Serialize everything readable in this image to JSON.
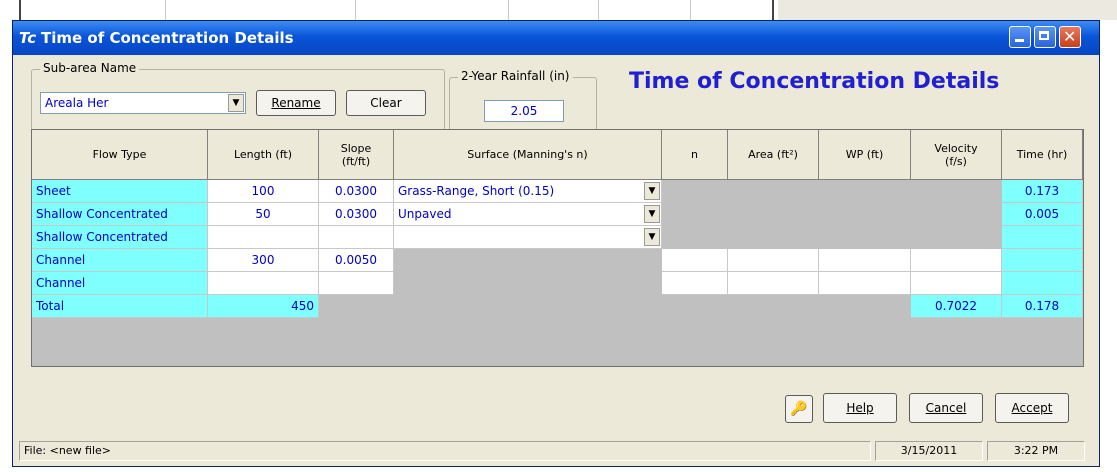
{
  "window": {
    "title": "Time of Concentration Details",
    "icon_text": "Tc",
    "close_glyph": "✕"
  },
  "subarea": {
    "label": "Sub-area Name",
    "value": "Areala Her",
    "rename_label": "Rename",
    "clear_label": "Clear"
  },
  "rainfall": {
    "label": "2-Year Rainfall (in)",
    "value": "2.05"
  },
  "heading": "Time of Concentration Details",
  "grid": {
    "headers": {
      "flow_type": "Flow Type",
      "length": "Length (ft)",
      "slope_1": "Slope",
      "slope_2": "(ft/ft)",
      "surface": "Surface (Manning's n)",
      "n": "n",
      "area": "Area (ft²)",
      "wp": "WP (ft)",
      "velocity_1": "Velocity",
      "velocity_2": "(f/s)",
      "time": "Time (hr)"
    },
    "rows": [
      {
        "flow_type": "Sheet",
        "length": "100",
        "slope": "0.0300",
        "surface": "Grass-Range, Short  (0.15)",
        "time": "0.173"
      },
      {
        "flow_type": "Shallow Concentrated",
        "length": "50",
        "slope": "0.0300",
        "surface": "Unpaved",
        "time": "0.005"
      },
      {
        "flow_type": "Shallow Concentrated",
        "length": "",
        "slope": "",
        "surface": "",
        "time": ""
      },
      {
        "flow_type": "Channel",
        "length": "300",
        "slope": "0.0050",
        "time": ""
      },
      {
        "flow_type": "Channel",
        "length": "",
        "slope": "",
        "time": ""
      }
    ],
    "total": {
      "label": "Total",
      "length": "450",
      "velocity": "0.7022",
      "time": "0.178"
    }
  },
  "buttons": {
    "help": "Help",
    "cancel": "Cancel",
    "accept": "Accept"
  },
  "icons": {
    "dropdown": "▼",
    "key": "🔑"
  },
  "status": {
    "file": "File: <new file>",
    "date": "3/15/2011",
    "time": "3:22 PM"
  },
  "colors": {
    "title_bar": "#0a55d8",
    "heading": "#2020d0",
    "cyan_cell": "#80ffff",
    "value_text": "#0000c8"
  }
}
